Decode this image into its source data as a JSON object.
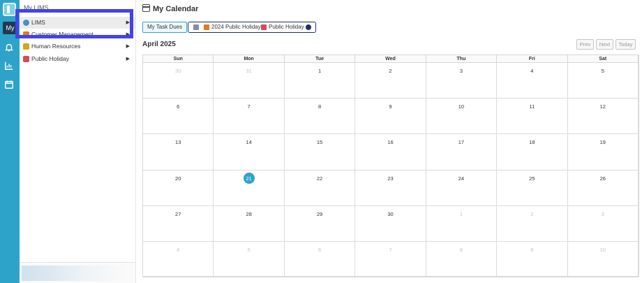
{
  "rail": {
    "my_label": "My"
  },
  "sidebar": {
    "header": "My LIMS",
    "items": [
      {
        "label": "LIMS",
        "icon": "globe-icon",
        "color": "#4a90c2"
      },
      {
        "label": "Customer Management",
        "icon": "people-icon",
        "color": "#e07a1e"
      },
      {
        "label": "Human Resources",
        "icon": "briefcase-icon",
        "color": "#d9a21b"
      },
      {
        "label": "Public Holiday",
        "icon": "calendar-icon",
        "color": "#d64a5a"
      }
    ]
  },
  "header": {
    "title": "My Calendar"
  },
  "filters": {
    "task_dues": "My Task Dues",
    "holiday_2024": "2024 Public Holiday",
    "public_holiday": "Public Holiday"
  },
  "calendar": {
    "month_title": "April 2025",
    "nav": {
      "prev": "Prev",
      "next": "Next",
      "today": "Today"
    },
    "weekdays": [
      "Sun",
      "Mon",
      "Tue",
      "Wed",
      "Thu",
      "Fri",
      "Sat"
    ],
    "weeks": [
      [
        "30",
        "31",
        "1",
        "2",
        "3",
        "4",
        "5"
      ],
      [
        "6",
        "7",
        "8",
        "9",
        "10",
        "11",
        "12"
      ],
      [
        "13",
        "14",
        "15",
        "16",
        "17",
        "18",
        "19"
      ],
      [
        "20",
        "21",
        "22",
        "23",
        "24",
        "25",
        "26"
      ],
      [
        "27",
        "28",
        "29",
        "30",
        "1",
        "2",
        "3"
      ],
      [
        "4",
        "5",
        "6",
        "7",
        "8",
        "9",
        "10"
      ]
    ],
    "today": "21",
    "accent": "#2ea3c9"
  }
}
